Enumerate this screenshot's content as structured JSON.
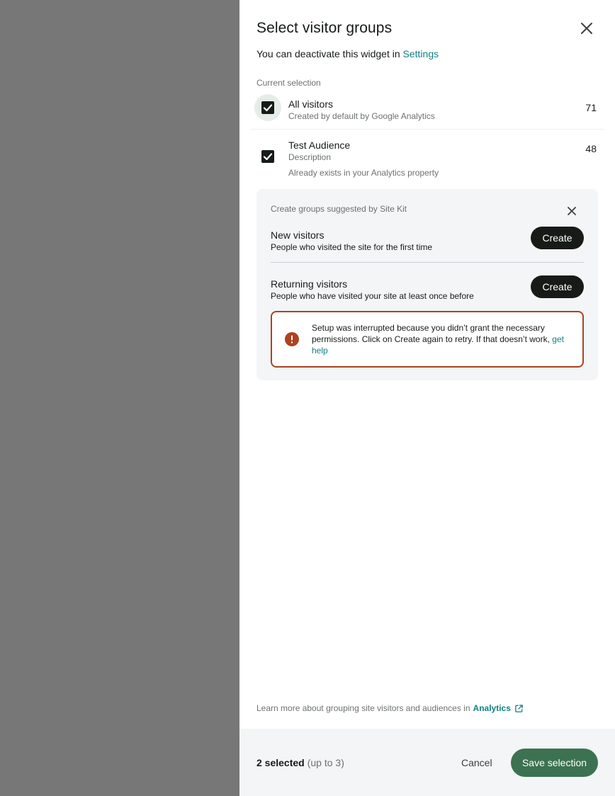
{
  "header": {
    "title": "Select visitor groups",
    "subtitle_prefix": "You can deactivate this widget in ",
    "settings_link": "Settings"
  },
  "current_selection": {
    "label": "Current selection",
    "audiences": [
      {
        "name": "All visitors",
        "description": "Created by default by Google Analytics",
        "count": "71",
        "checked": true
      },
      {
        "name": "Test Audience",
        "description": "Description",
        "note": "Already exists in your Analytics property",
        "count": "48",
        "checked": true
      }
    ]
  },
  "suggestions": {
    "title": "Create groups suggested by Site Kit",
    "items": [
      {
        "name": "New visitors",
        "description": "People who visited the site for the first time",
        "button": "Create"
      },
      {
        "name": "Returning visitors",
        "description": "People who have visited your site at least once before",
        "button": "Create"
      }
    ],
    "error": {
      "message": "Setup was interrupted because you didn’t grant the necessary permissions. Click on Create again to retry. If that doesn’t work, ",
      "link": "get help"
    }
  },
  "learn_more": {
    "text": "Learn more about grouping site visitors and audiences in",
    "link": "Analytics"
  },
  "footer": {
    "selected_count": "2 selected",
    "max_note": "(up to 3)",
    "cancel_label": "Cancel",
    "save_label": "Save selection"
  },
  "colors": {
    "accent_link": "#108080",
    "save_button": "#3c7251",
    "error_border": "#ac4220",
    "overlay": "#777777"
  }
}
